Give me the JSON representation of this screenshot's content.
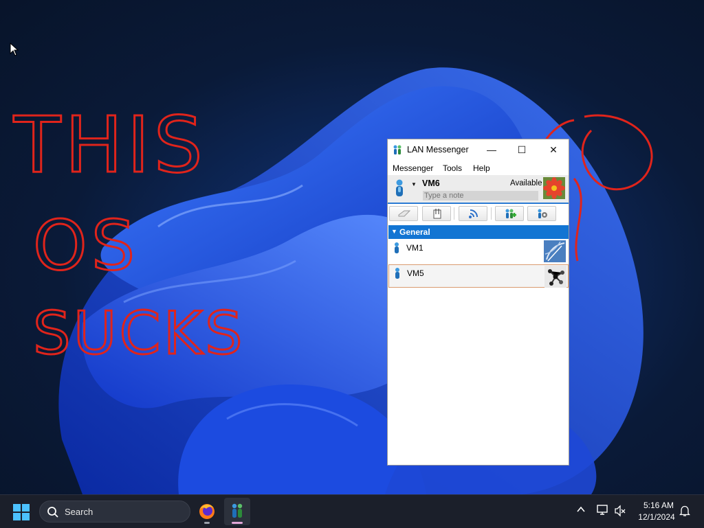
{
  "desktop": {
    "scribble": {
      "line1": "THIS",
      "line2": "OS",
      "line3": "SUCKS",
      "color": "#e0241b"
    }
  },
  "window": {
    "title": "LAN Messenger",
    "controls": {
      "minimize": "—",
      "maximize": "☐",
      "close": "✕"
    },
    "menu": [
      "Messenger",
      "Tools",
      "Help"
    ],
    "user": {
      "name": "VM6",
      "status": "Available",
      "note_placeholder": "Type a note"
    },
    "toolbar": [
      "chat-icon",
      "file-transfer-icon",
      "broadcast-icon",
      "add-contact-icon",
      "settings-icon"
    ],
    "group": {
      "name": "General",
      "expanded": true
    },
    "contacts": [
      {
        "name": "VM1",
        "avatar": "satellite-dish"
      },
      {
        "name": "VM5",
        "avatar": "molecule",
        "selected": true
      }
    ],
    "accent": "#1275d3"
  },
  "taskbar": {
    "search_label": "Search",
    "apps": [
      "firefox",
      "lan-messenger"
    ],
    "clock": {
      "time": "5:16 AM",
      "date": "12/1/2024"
    }
  }
}
